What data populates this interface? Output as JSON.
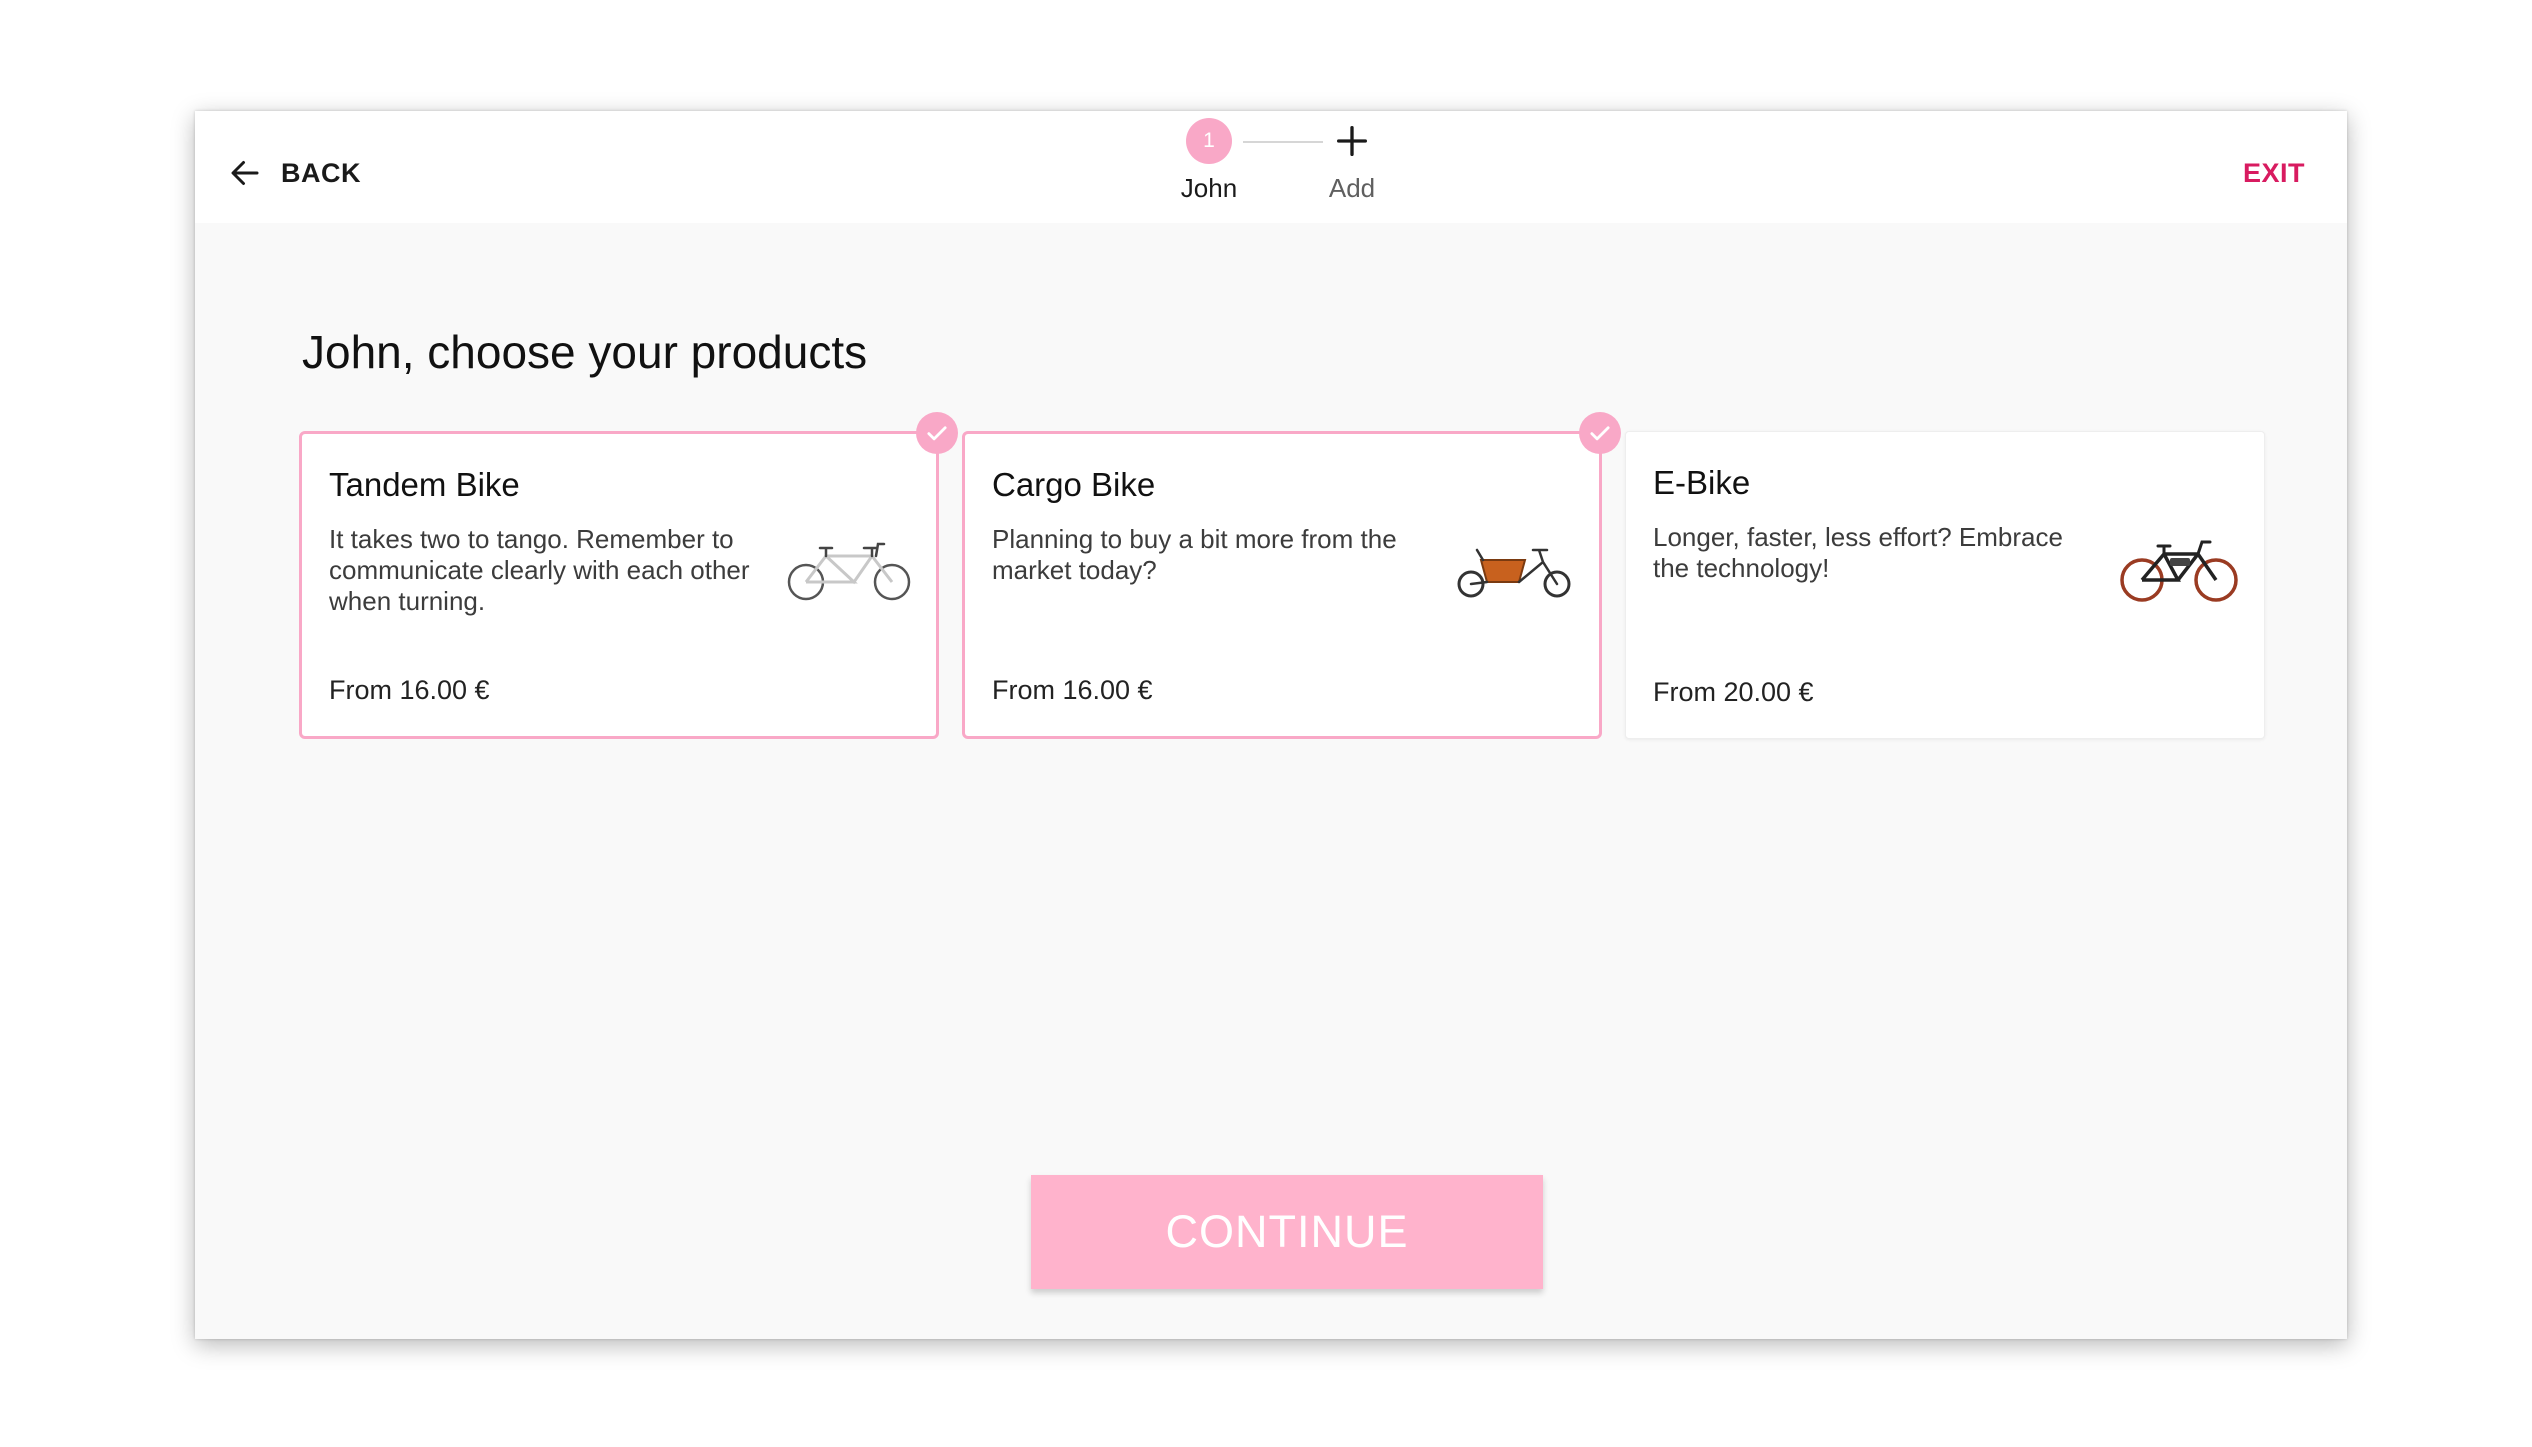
{
  "header": {
    "back_label": "BACK",
    "exit_label": "EXIT",
    "back_icon": "arrow-left-icon"
  },
  "stepper": {
    "steps": [
      {
        "number": "1",
        "label": "John",
        "active": true
      },
      {
        "icon": "plus-icon",
        "label": "Add",
        "active": false
      }
    ]
  },
  "main": {
    "title": "John, choose your products",
    "products": [
      {
        "name": "Tandem Bike",
        "description": "It takes two to tango. Remember to communicate clearly with each other when turning.",
        "price": "From 16.00 €",
        "selected": true,
        "image_icon": "tandem-bike-icon"
      },
      {
        "name": "Cargo Bike",
        "description": "Planning to buy a bit more from the market today?",
        "price": "From 16.00 €",
        "selected": true,
        "image_icon": "cargo-bike-icon"
      },
      {
        "name": "E-Bike",
        "description": "Longer, faster, less effort? Embrace the technology!",
        "price": "From 20.00 €",
        "selected": false,
        "image_icon": "e-bike-icon"
      }
    ],
    "continue_label": "CONTINUE"
  },
  "colors": {
    "accent_pink": "#f9a8c7",
    "exit_red": "#d81b60",
    "continue_bg": "#ffb3cc"
  }
}
